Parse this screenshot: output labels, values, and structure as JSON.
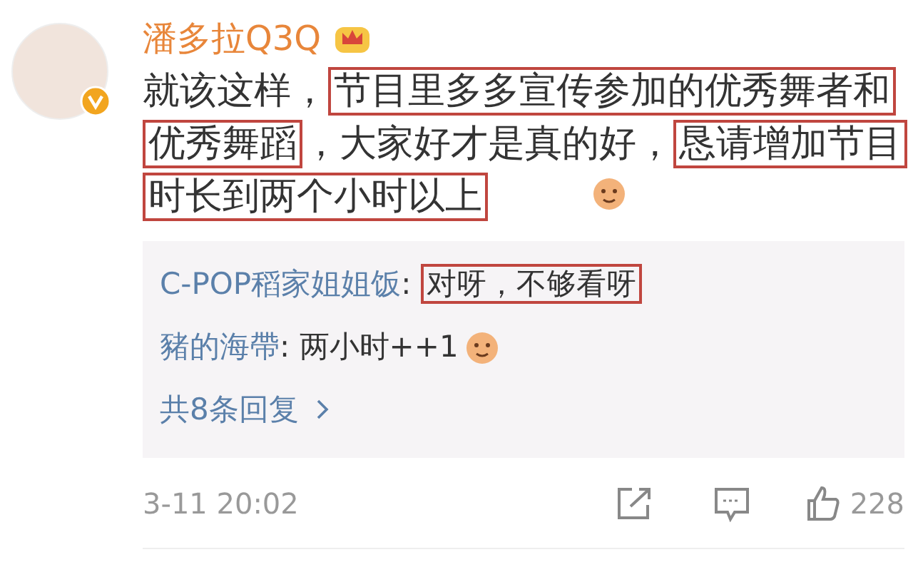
{
  "comment": {
    "author": "潘多拉Q3Q",
    "verified": true,
    "content": [
      {
        "text": "就该这样，",
        "highlighted": false
      },
      {
        "text": "节目里多多宣传参加的优秀舞者和优秀舞蹈",
        "highlighted": true
      },
      {
        "text": "，大家好才是真的好，",
        "highlighted": false
      },
      {
        "text": "恳请增加节目时长到两个小时以上",
        "highlighted": true
      }
    ],
    "replies": [
      {
        "author": "C-POP稻家姐姐饭",
        "content": [
          {
            "text": ": ",
            "highlighted": false
          },
          {
            "text": "对呀，不够看呀",
            "highlighted": true
          }
        ],
        "emoji": false
      },
      {
        "author": "豬的海帶",
        "content": [
          {
            "text": ": 两小时++1",
            "highlighted": false
          }
        ],
        "emoji": true
      }
    ],
    "more_replies": "共8条回复",
    "timestamp": "3-11 20:02",
    "likes": "228"
  }
}
